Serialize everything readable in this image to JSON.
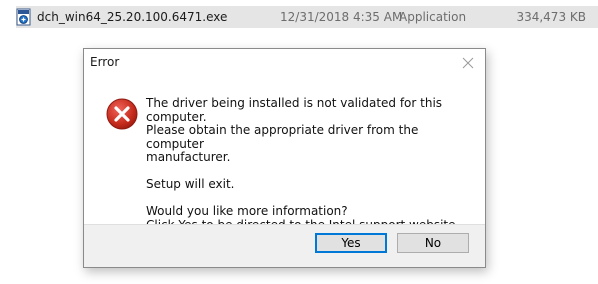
{
  "explorer": {
    "file_name": "dch_win64_25.20.100.6471.exe",
    "date_modified": "12/31/2018 4:35 AM",
    "type": "Application",
    "size": "334,473 KB",
    "icon": "installer-exe-icon"
  },
  "dialog": {
    "title": "Error",
    "close_icon": "close-icon",
    "status_icon": "error-icon",
    "message_lines": [
      "The driver being installed is not validated for this computer.",
      "Please obtain the appropriate driver from the computer",
      "manufacturer."
    ],
    "setup_line": "Setup will exit.",
    "question_lines": [
      "Would you like more information?",
      "Click Yes to be directed to the Intel support website."
    ],
    "buttons": {
      "yes_label": "Yes",
      "no_label": "No"
    }
  },
  "colors": {
    "error_red": "#c42b1c",
    "focus_blue": "#0078d7",
    "row_highlight": "#e5e5e5"
  }
}
